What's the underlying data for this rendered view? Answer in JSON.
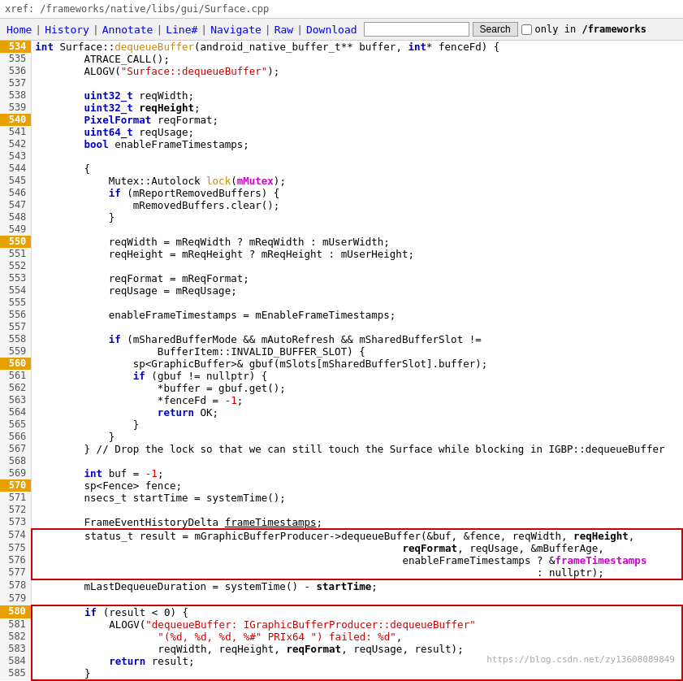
{
  "pathbar": {
    "text": "xref: /frameworks/native/libs/gui/Surface.cpp"
  },
  "navbar": {
    "home": "Home",
    "history": "History",
    "annotate": "Annotate",
    "linenum": "Line#",
    "navigate": "Navigate",
    "raw": "Raw",
    "download": "Download",
    "search_placeholder": "",
    "search_btn": "Search",
    "only_label": "only in",
    "frameworks_label": "/frameworks"
  },
  "highlighted_line": "534",
  "watermark": "https://blog.csdn.net/zy13608089849"
}
